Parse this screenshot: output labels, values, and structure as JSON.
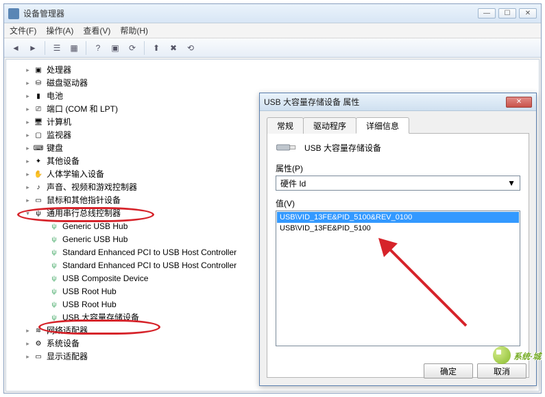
{
  "window": {
    "title": "设备管理器",
    "menu": {
      "file": "文件(F)",
      "action": "操作(A)",
      "view": "查看(V)",
      "help": "帮助(H)"
    }
  },
  "tree": {
    "items": [
      {
        "label": "处理器",
        "icon": "cpu"
      },
      {
        "label": "磁盘驱动器",
        "icon": "disk"
      },
      {
        "label": "电池",
        "icon": "battery"
      },
      {
        "label": "端口 (COM 和 LPT)",
        "icon": "port"
      },
      {
        "label": "计算机",
        "icon": "computer"
      },
      {
        "label": "监视器",
        "icon": "monitor"
      },
      {
        "label": "键盘",
        "icon": "keyboard"
      },
      {
        "label": "其他设备",
        "icon": "other"
      },
      {
        "label": "人体学输入设备",
        "icon": "hid"
      },
      {
        "label": "声音、视频和游戏控制器",
        "icon": "sound"
      },
      {
        "label": "鼠标和其他指针设备",
        "icon": "mouse"
      },
      {
        "label": "通用串行总线控制器",
        "icon": "usb",
        "expanded": true,
        "children": [
          {
            "label": "Generic USB Hub"
          },
          {
            "label": "Generic USB Hub"
          },
          {
            "label": "Standard Enhanced PCI to USB Host Controller"
          },
          {
            "label": "Standard Enhanced PCI to USB Host Controller"
          },
          {
            "label": "USB Composite Device"
          },
          {
            "label": "USB Root Hub"
          },
          {
            "label": "USB Root Hub"
          },
          {
            "label": "USB 大容量存储设备"
          }
        ]
      },
      {
        "label": "网络适配器",
        "icon": "network"
      },
      {
        "label": "系统设备",
        "icon": "system"
      },
      {
        "label": "显示适配器",
        "icon": "display"
      }
    ]
  },
  "dialog": {
    "title": "USB 大容量存储设备 属性",
    "tabs": {
      "general": "常规",
      "driver": "驱动程序",
      "details": "详细信息"
    },
    "device_name": "USB 大容量存储设备",
    "property_label": "属性(P)",
    "property_value": "硬件 Id",
    "value_label": "值(V)",
    "values": [
      "USB\\VID_13FE&PID_5100&REV_0100",
      "USB\\VID_13FE&PID_5100"
    ],
    "ok": "确定",
    "cancel": "取消"
  },
  "watermark": "系统·城"
}
